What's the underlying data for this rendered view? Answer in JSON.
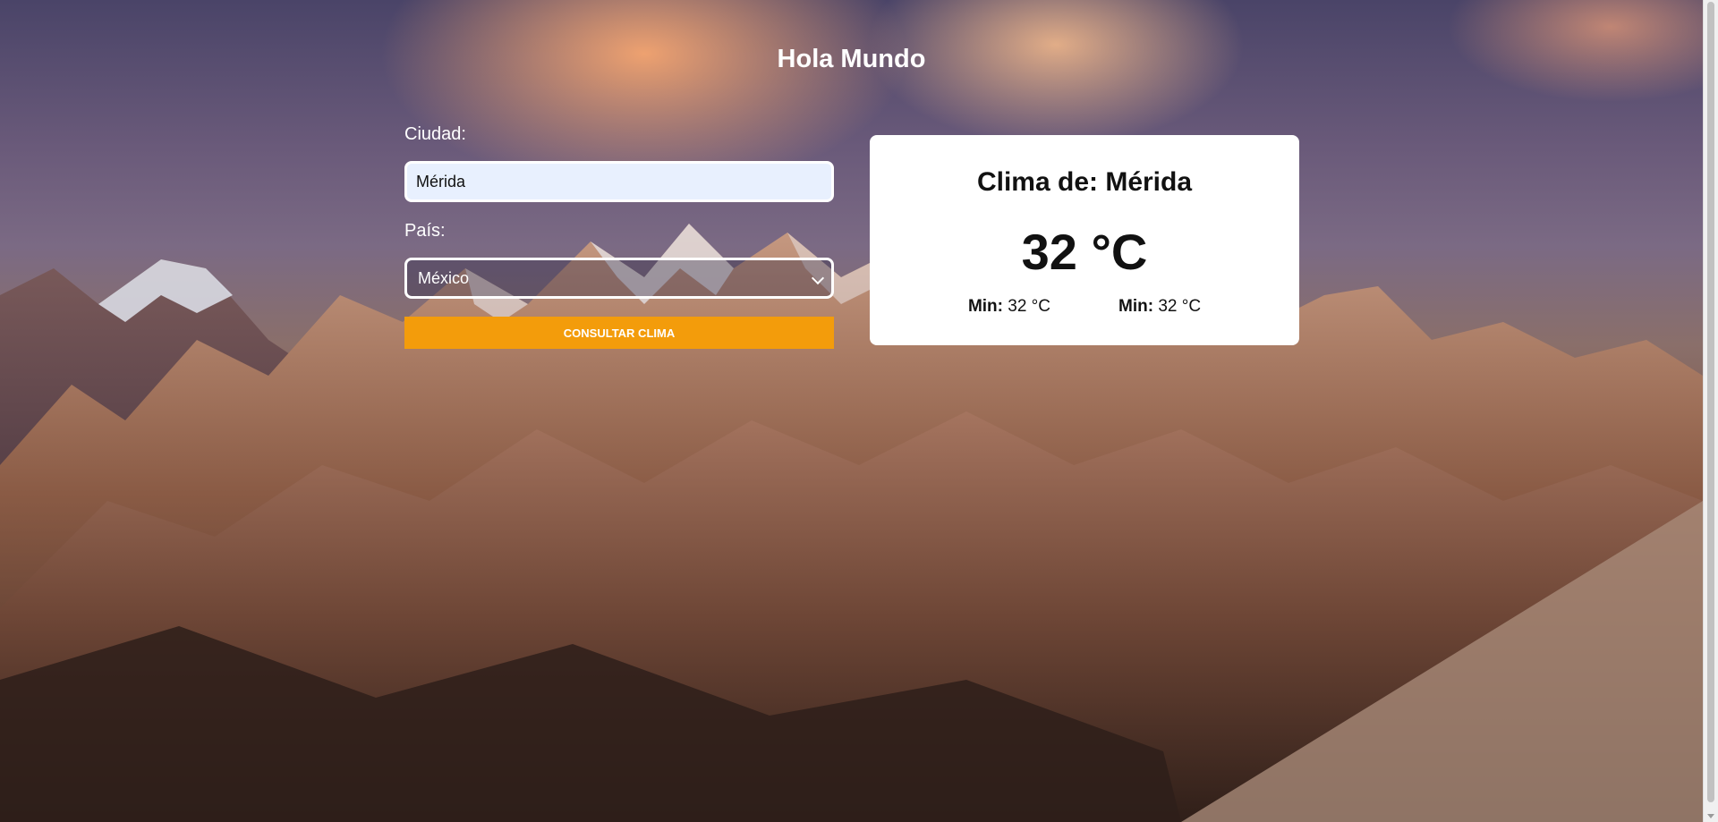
{
  "page": {
    "title": "Hola Mundo"
  },
  "form": {
    "city_label": "Ciudad:",
    "city_value": "Mérida",
    "country_label": "País:",
    "country_value": "México",
    "submit_label": "Consultar clima"
  },
  "result": {
    "heading": "Clima de: Mérida",
    "temperature": "32 °C",
    "stats": [
      {
        "label": "Min:",
        "value": "32 °C"
      },
      {
        "label": "Min:",
        "value": "32 °C"
      }
    ]
  },
  "colors": {
    "accent_button": "#f39c0b",
    "card_background": "#ffffff",
    "input_background": "#e8f0fe"
  },
  "icons": {
    "select_arrow": "chevron-down-icon"
  }
}
